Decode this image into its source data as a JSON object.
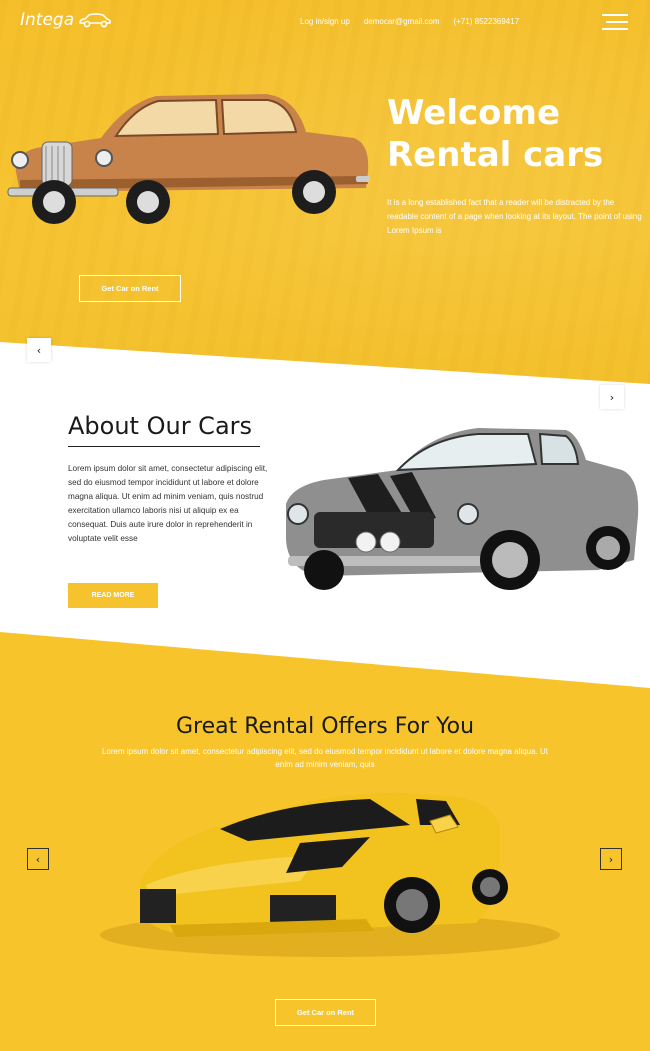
{
  "header": {
    "logo_text": "Intega",
    "nav": [
      "Log in/sign up",
      "democar@gmail.com",
      "(+71) 8522369417"
    ]
  },
  "hero": {
    "title_line1": "Welcome",
    "title_line2": "Rental cars",
    "text": "It is a long established fact that a reader will be distracted by the readable content of a page when looking at its layout. The point of using Lorem Ipsum is",
    "button": "Get Car on Rent"
  },
  "about": {
    "title": "About Our Cars",
    "text": "Lorem ipsum dolor sit amet, consectetur adipiscing elit, sed do eiusmod tempor incididunt ut labore et dolore magna aliqua. Ut enim ad minim veniam, quis nostrud exercitation ullamco laboris nisi ut aliquip ex ea consequat. Duis aute irure dolor in reprehenderit in voluptate velit esse",
    "button": "READ MORE"
  },
  "offers": {
    "title": "Great Rental Offers For You",
    "text": "Lorem ipsum dolor sit amet, consectetur adipiscing elit, sed do eiusmod tempor incididunt ut labore et dolore magna aliqua. Ut enim ad minim veniam, quis",
    "button": "Get Car on Rent"
  },
  "arrows": {
    "prev": "‹",
    "next": "›"
  },
  "colors": {
    "accent": "#f6c22d",
    "white": "#ffffff",
    "text_dark": "#1a1a1a"
  }
}
